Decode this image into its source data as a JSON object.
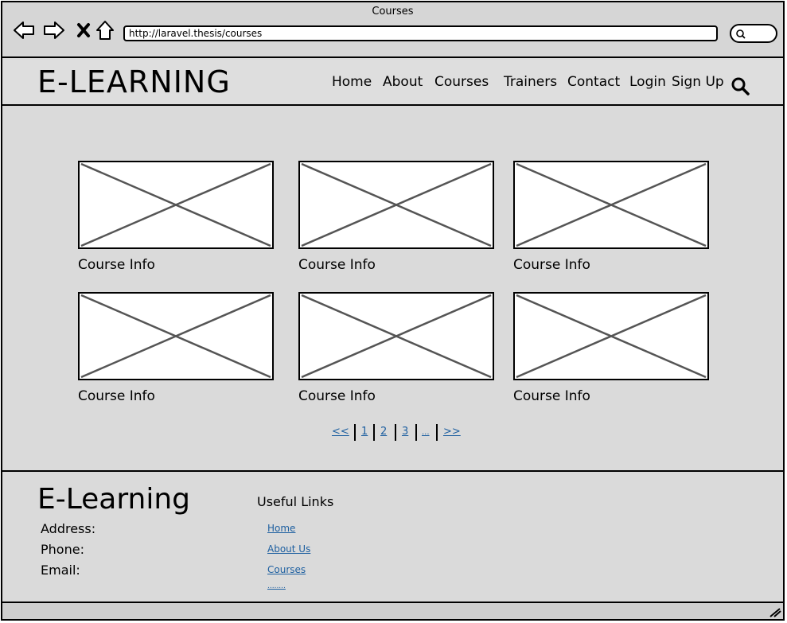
{
  "window": {
    "title": "Courses",
    "url": "http://laravel.thesis/courses"
  },
  "header": {
    "logo": "E-LEARNING",
    "menu": [
      "Home",
      "About",
      "Courses",
      "Trainers",
      "Contact",
      "Login",
      "Sign Up"
    ]
  },
  "courses": {
    "items": [
      {
        "label": "Course Info"
      },
      {
        "label": "Course Info"
      },
      {
        "label": "Course Info"
      },
      {
        "label": "Course Info"
      },
      {
        "label": "Course Info"
      },
      {
        "label": "Course Info"
      }
    ]
  },
  "pagination": {
    "prev": "<<",
    "pages": [
      "1",
      "2",
      "3",
      "..."
    ],
    "next": ">>"
  },
  "footer": {
    "logo": "E-Learning",
    "address_label": "Address:",
    "phone_label": "Phone:",
    "email_label": "Email:",
    "links_heading": "Useful Links",
    "links": [
      "Home",
      "About Us",
      "Courses",
      "........"
    ]
  },
  "colors": {
    "link": "#1d5fa0",
    "background": "#dadada"
  }
}
